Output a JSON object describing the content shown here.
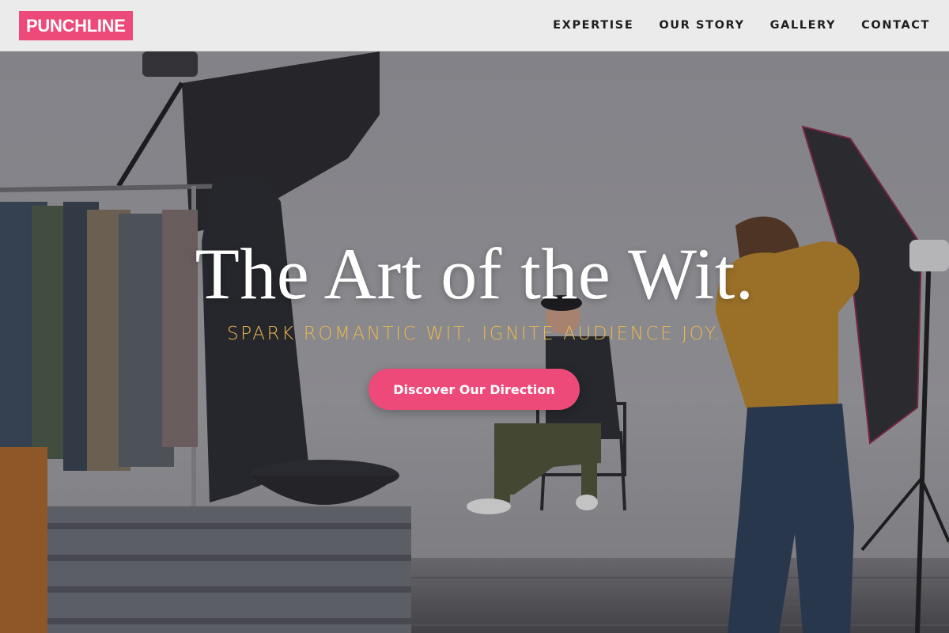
{
  "brand": {
    "logo_text": "PUNCHLINE",
    "accent_color": "#ee4a79"
  },
  "nav": {
    "items": [
      {
        "label": "EXPERTISE"
      },
      {
        "label": "OUR STORY"
      },
      {
        "label": "GALLERY"
      },
      {
        "label": "CONTACT"
      }
    ]
  },
  "hero": {
    "title": "The Art of the Wit.",
    "subtitle": "SPARK ROMANTIC WIT, IGNITE AUDIENCE JOY.",
    "subtitle_color": "#e9b94f",
    "cta_label": "Discover Our Direction"
  }
}
